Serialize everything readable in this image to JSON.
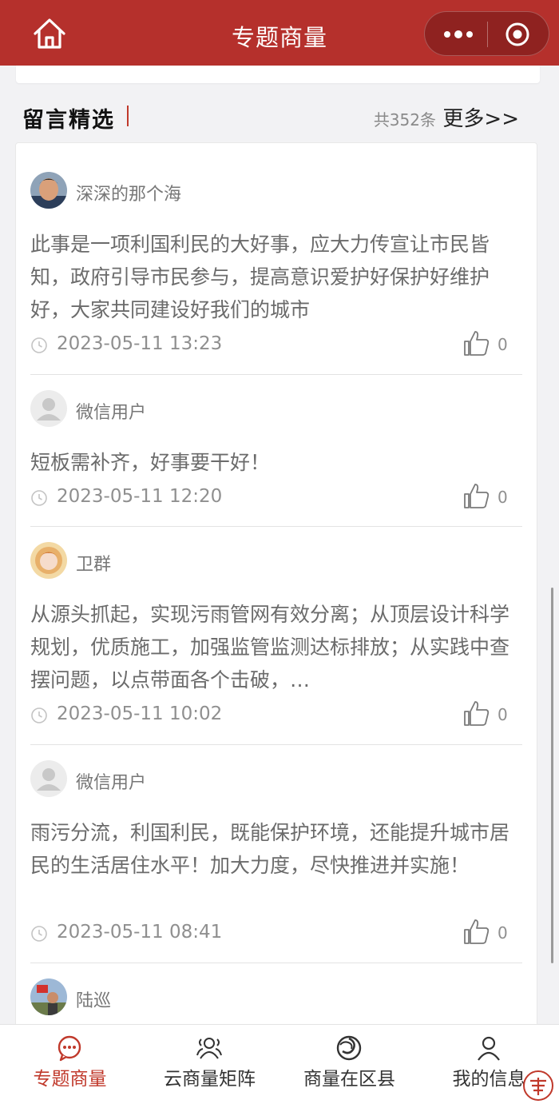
{
  "header": {
    "title": "专题商量"
  },
  "section": {
    "title": "留言精选",
    "count": "共352条",
    "more": "更多>>"
  },
  "comments": [
    {
      "user": "深深的那个海",
      "text": "此事是一项利国利民的大好事，应大力传宣让市民皆知，政府引导市民参与，提高意识爱护好保护好维护好，大家共同建设好我们的城市",
      "time": "2023-05-11 13:23",
      "likes": "0"
    },
    {
      "user": "微信用户",
      "text": "短板需补齐，好事要干好！",
      "time": "2023-05-11 12:20",
      "likes": "0"
    },
    {
      "user": "卫群",
      "text": "从源头抓起，实现污雨管网有效分离；从顶层设计科学规划，优质施工，加强监管监测达标排放；从实践中查摆问题，以点带面各个击破，…",
      "time": "2023-05-11 10:02",
      "likes": "0"
    },
    {
      "user": "微信用户",
      "text": "雨污分流，利国利民，既能保护环境，还能提升城市居民的生活居住水平！加大力度，尽快推进并实施！",
      "time": "2023-05-11 08:41",
      "likes": "0"
    },
    {
      "user": "陆巡"
    }
  ],
  "tabs": [
    {
      "label": "专题商量",
      "icon": "chat-bubble-icon",
      "active": true
    },
    {
      "label": "云商量矩阵",
      "icon": "people-icon",
      "active": false
    },
    {
      "label": "商量在区县",
      "icon": "swirl-icon",
      "active": false
    },
    {
      "label": "我的信息",
      "icon": "person-icon",
      "active": false
    }
  ],
  "colors": {
    "brand": "#b5302c",
    "accent": "#c0392b"
  }
}
